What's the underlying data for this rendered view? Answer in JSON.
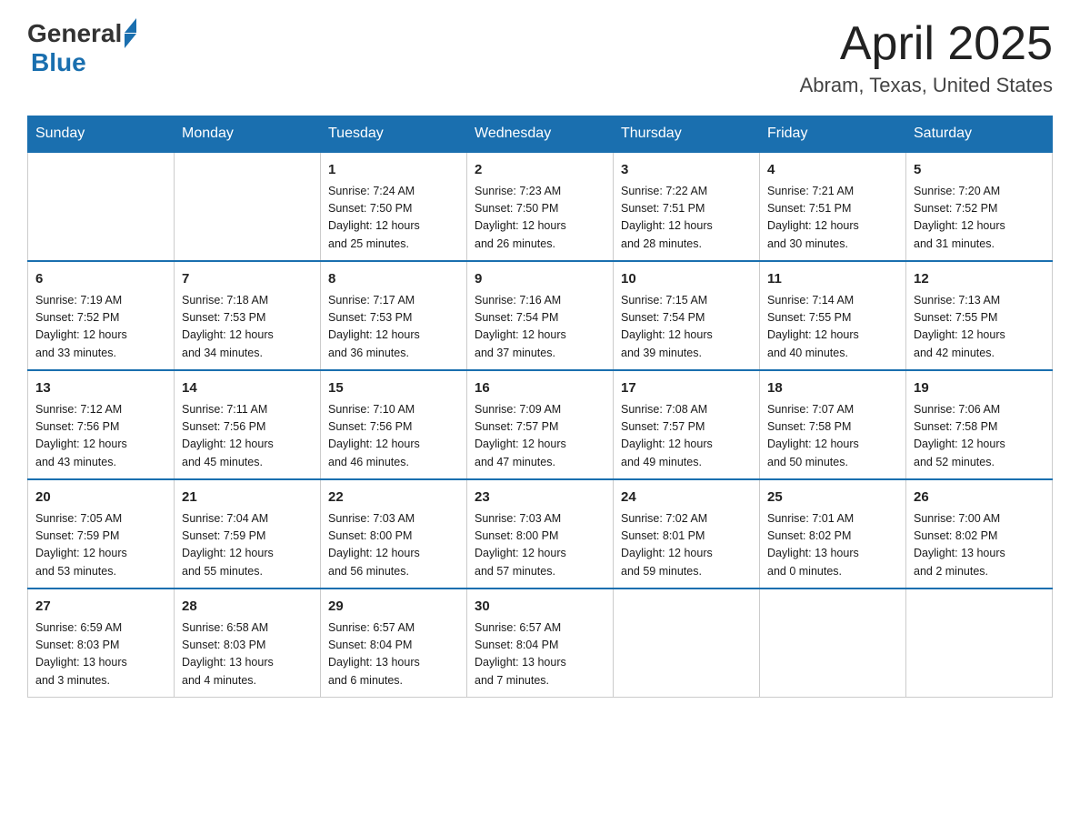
{
  "header": {
    "logo_general": "General",
    "logo_blue": "Blue",
    "month_title": "April 2025",
    "location": "Abram, Texas, United States"
  },
  "days_of_week": [
    "Sunday",
    "Monday",
    "Tuesday",
    "Wednesday",
    "Thursday",
    "Friday",
    "Saturday"
  ],
  "weeks": [
    [
      {
        "day": "",
        "info": ""
      },
      {
        "day": "",
        "info": ""
      },
      {
        "day": "1",
        "info": "Sunrise: 7:24 AM\nSunset: 7:50 PM\nDaylight: 12 hours\nand 25 minutes."
      },
      {
        "day": "2",
        "info": "Sunrise: 7:23 AM\nSunset: 7:50 PM\nDaylight: 12 hours\nand 26 minutes."
      },
      {
        "day": "3",
        "info": "Sunrise: 7:22 AM\nSunset: 7:51 PM\nDaylight: 12 hours\nand 28 minutes."
      },
      {
        "day": "4",
        "info": "Sunrise: 7:21 AM\nSunset: 7:51 PM\nDaylight: 12 hours\nand 30 minutes."
      },
      {
        "day": "5",
        "info": "Sunrise: 7:20 AM\nSunset: 7:52 PM\nDaylight: 12 hours\nand 31 minutes."
      }
    ],
    [
      {
        "day": "6",
        "info": "Sunrise: 7:19 AM\nSunset: 7:52 PM\nDaylight: 12 hours\nand 33 minutes."
      },
      {
        "day": "7",
        "info": "Sunrise: 7:18 AM\nSunset: 7:53 PM\nDaylight: 12 hours\nand 34 minutes."
      },
      {
        "day": "8",
        "info": "Sunrise: 7:17 AM\nSunset: 7:53 PM\nDaylight: 12 hours\nand 36 minutes."
      },
      {
        "day": "9",
        "info": "Sunrise: 7:16 AM\nSunset: 7:54 PM\nDaylight: 12 hours\nand 37 minutes."
      },
      {
        "day": "10",
        "info": "Sunrise: 7:15 AM\nSunset: 7:54 PM\nDaylight: 12 hours\nand 39 minutes."
      },
      {
        "day": "11",
        "info": "Sunrise: 7:14 AM\nSunset: 7:55 PM\nDaylight: 12 hours\nand 40 minutes."
      },
      {
        "day": "12",
        "info": "Sunrise: 7:13 AM\nSunset: 7:55 PM\nDaylight: 12 hours\nand 42 minutes."
      }
    ],
    [
      {
        "day": "13",
        "info": "Sunrise: 7:12 AM\nSunset: 7:56 PM\nDaylight: 12 hours\nand 43 minutes."
      },
      {
        "day": "14",
        "info": "Sunrise: 7:11 AM\nSunset: 7:56 PM\nDaylight: 12 hours\nand 45 minutes."
      },
      {
        "day": "15",
        "info": "Sunrise: 7:10 AM\nSunset: 7:56 PM\nDaylight: 12 hours\nand 46 minutes."
      },
      {
        "day": "16",
        "info": "Sunrise: 7:09 AM\nSunset: 7:57 PM\nDaylight: 12 hours\nand 47 minutes."
      },
      {
        "day": "17",
        "info": "Sunrise: 7:08 AM\nSunset: 7:57 PM\nDaylight: 12 hours\nand 49 minutes."
      },
      {
        "day": "18",
        "info": "Sunrise: 7:07 AM\nSunset: 7:58 PM\nDaylight: 12 hours\nand 50 minutes."
      },
      {
        "day": "19",
        "info": "Sunrise: 7:06 AM\nSunset: 7:58 PM\nDaylight: 12 hours\nand 52 minutes."
      }
    ],
    [
      {
        "day": "20",
        "info": "Sunrise: 7:05 AM\nSunset: 7:59 PM\nDaylight: 12 hours\nand 53 minutes."
      },
      {
        "day": "21",
        "info": "Sunrise: 7:04 AM\nSunset: 7:59 PM\nDaylight: 12 hours\nand 55 minutes."
      },
      {
        "day": "22",
        "info": "Sunrise: 7:03 AM\nSunset: 8:00 PM\nDaylight: 12 hours\nand 56 minutes."
      },
      {
        "day": "23",
        "info": "Sunrise: 7:03 AM\nSunset: 8:00 PM\nDaylight: 12 hours\nand 57 minutes."
      },
      {
        "day": "24",
        "info": "Sunrise: 7:02 AM\nSunset: 8:01 PM\nDaylight: 12 hours\nand 59 minutes."
      },
      {
        "day": "25",
        "info": "Sunrise: 7:01 AM\nSunset: 8:02 PM\nDaylight: 13 hours\nand 0 minutes."
      },
      {
        "day": "26",
        "info": "Sunrise: 7:00 AM\nSunset: 8:02 PM\nDaylight: 13 hours\nand 2 minutes."
      }
    ],
    [
      {
        "day": "27",
        "info": "Sunrise: 6:59 AM\nSunset: 8:03 PM\nDaylight: 13 hours\nand 3 minutes."
      },
      {
        "day": "28",
        "info": "Sunrise: 6:58 AM\nSunset: 8:03 PM\nDaylight: 13 hours\nand 4 minutes."
      },
      {
        "day": "29",
        "info": "Sunrise: 6:57 AM\nSunset: 8:04 PM\nDaylight: 13 hours\nand 6 minutes."
      },
      {
        "day": "30",
        "info": "Sunrise: 6:57 AM\nSunset: 8:04 PM\nDaylight: 13 hours\nand 7 minutes."
      },
      {
        "day": "",
        "info": ""
      },
      {
        "day": "",
        "info": ""
      },
      {
        "day": "",
        "info": ""
      }
    ]
  ]
}
